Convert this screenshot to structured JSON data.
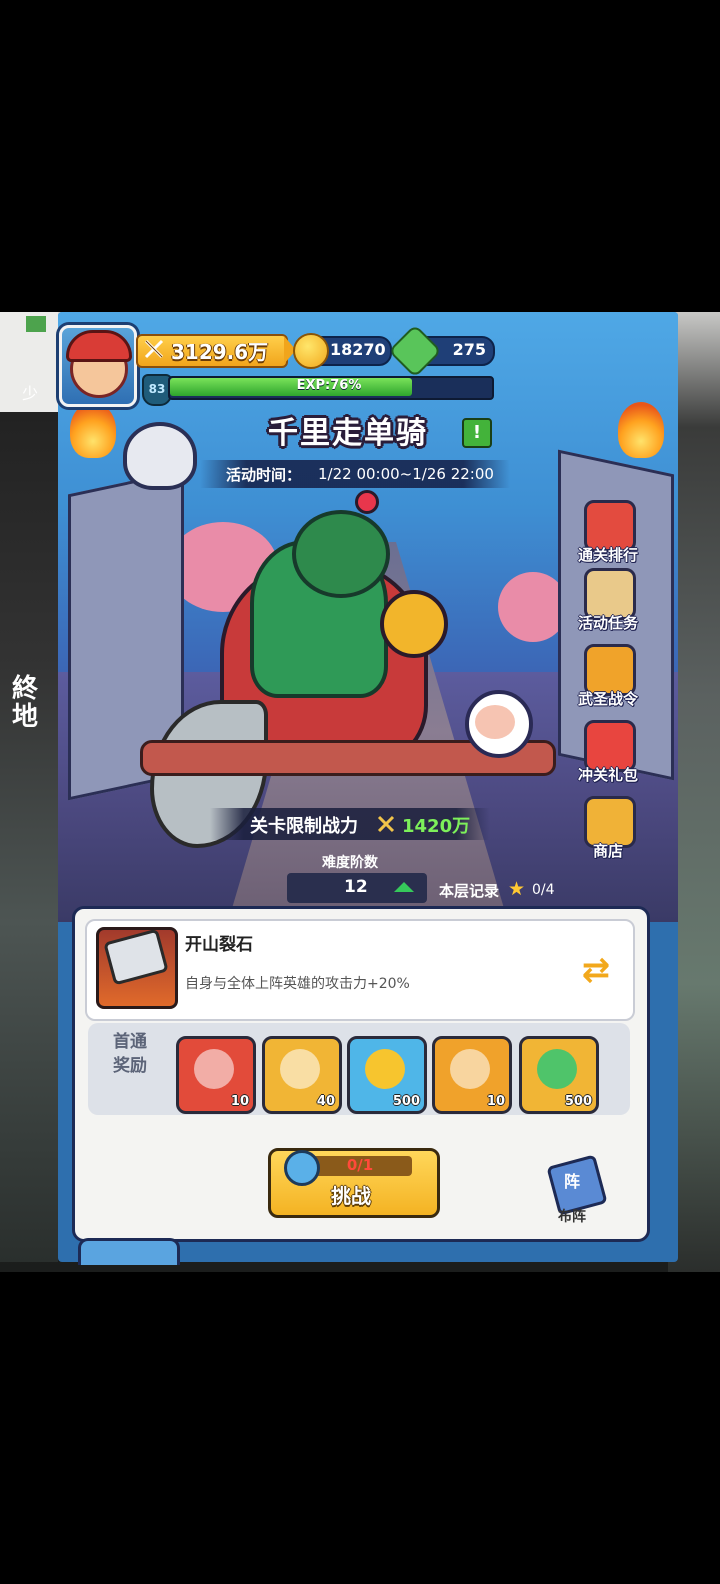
{
  "side_text": {
    "left_top": "少",
    "left_lower_line1": "終",
    "left_lower_line2": "地"
  },
  "player": {
    "level": "83",
    "power": "3129.6万",
    "coins": "18270",
    "gems": "275",
    "exp_text": "EXP:76%",
    "exp_fraction": 0.76
  },
  "event": {
    "title": "千里走单骑",
    "alert_glyph": "!",
    "time_label": "活动时间：",
    "time_value": "1/22 00:00~1/26 22:00"
  },
  "right_menu": [
    {
      "label": "通关排行",
      "icon": "ranking-banner-icon",
      "color": "#e34b3f"
    },
    {
      "label": "活动任务",
      "icon": "task-scroll-icon",
      "color": "#e9c98a"
    },
    {
      "label": "武圣战令",
      "icon": "war-order-icon",
      "color": "#f0a32a"
    },
    {
      "label": "冲关礼包",
      "icon": "gift-pack-icon",
      "color": "#e8453f"
    },
    {
      "label": "商店",
      "icon": "shop-icon",
      "color": "#f0b237"
    }
  ],
  "stage": {
    "limit_label": "关卡限制战力",
    "limit_value": "1420万",
    "difficulty_label": "难度阶数",
    "difficulty_value": "12",
    "record_label": "本层记录",
    "record_value": "0/4"
  },
  "buff": {
    "name": "开山裂石",
    "description": "自身与全体上阵英雄的攻击力+20%"
  },
  "rewards": {
    "label": "首通奖励",
    "items": [
      {
        "icon": "hero-guanyu-icon",
        "count": "10",
        "color": "#e24b3a"
      },
      {
        "icon": "hero-general-icon",
        "count": "40",
        "color": "#f1b535"
      },
      {
        "icon": "gold-coin-icon",
        "count": "500",
        "color": "#4fb6e8"
      },
      {
        "icon": "orange-gem-icon",
        "count": "10",
        "color": "#f0a22b"
      },
      {
        "icon": "green-star-badge-icon",
        "count": "500",
        "color": "#f1b535"
      }
    ]
  },
  "challenge": {
    "progress": "0/1",
    "label": "挑战"
  },
  "formation": {
    "icon_text": "阵",
    "label": "布阵"
  },
  "colors": {
    "accent_gold": "#f4b323",
    "limit_green": "#7df05a",
    "exp_green": "#2ea52d",
    "frame_navy": "#1d2a55"
  }
}
